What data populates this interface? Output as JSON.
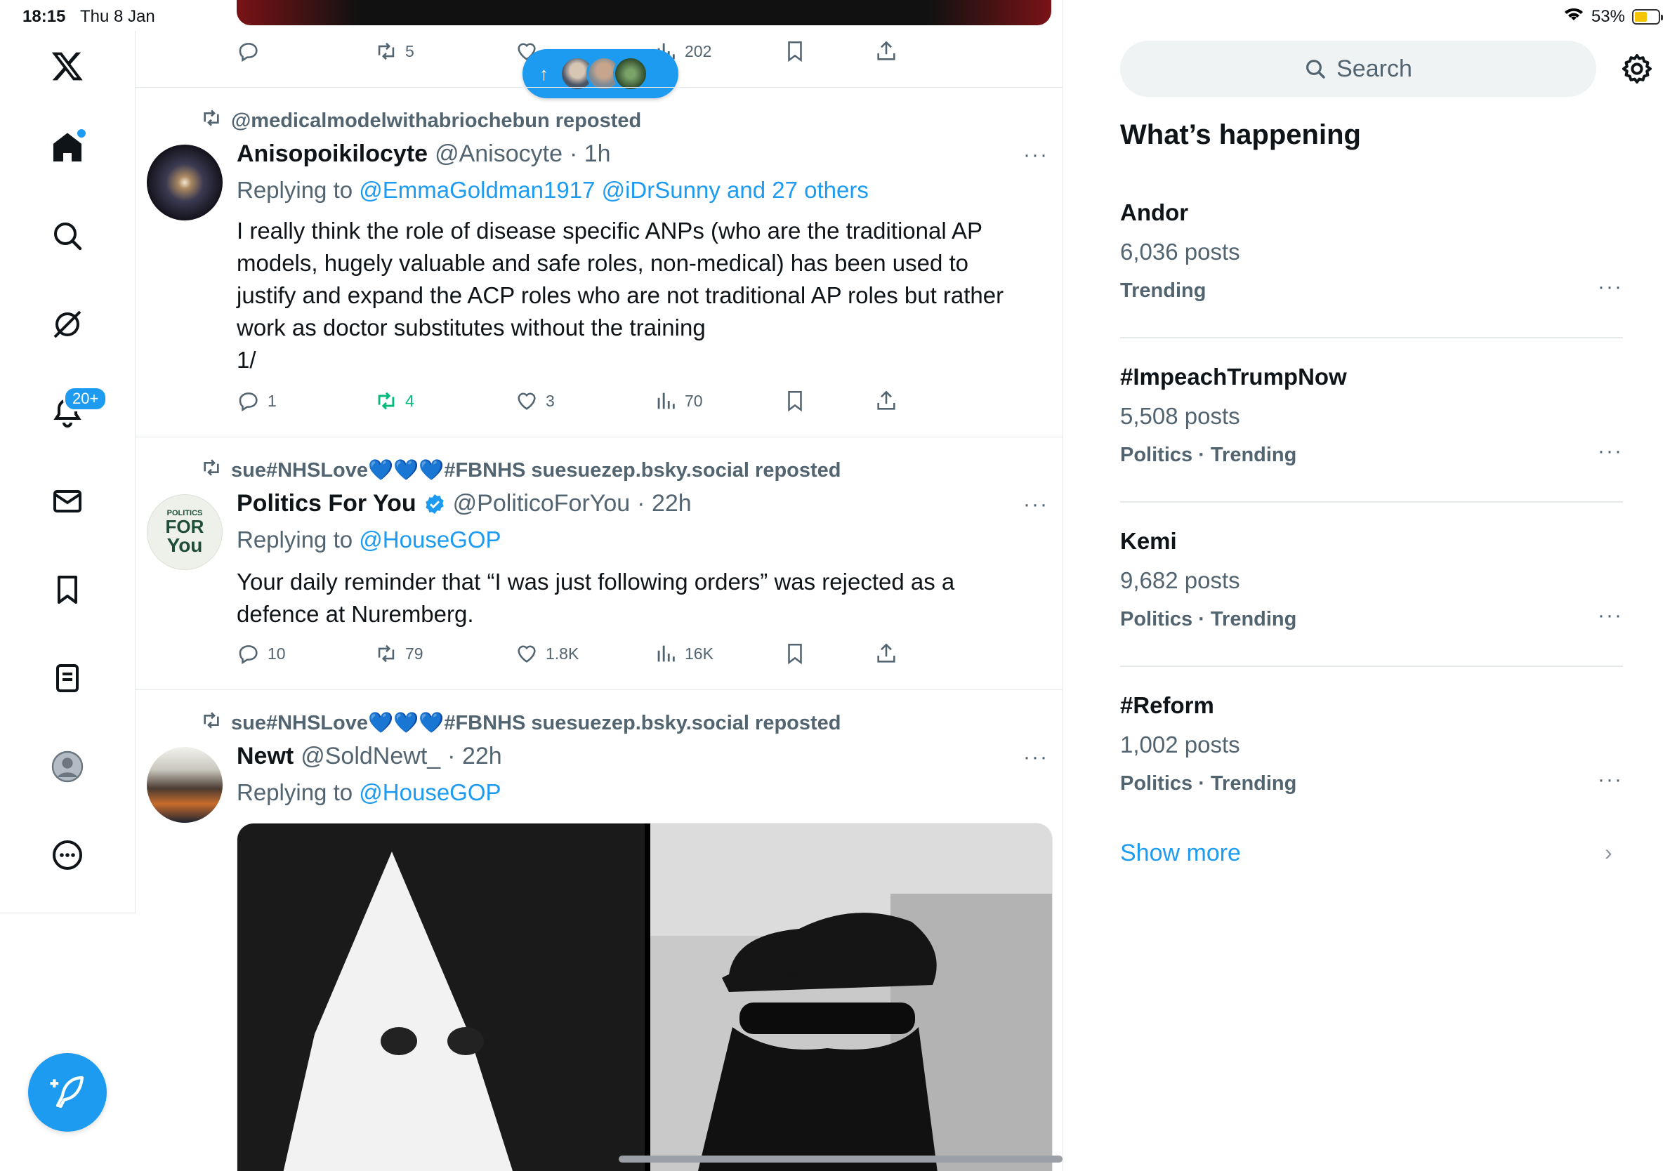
{
  "status_bar": {
    "time": "18:15",
    "date": "Thu 8 Jan",
    "battery": "53%",
    "battery_level": 0.53
  },
  "nav": {
    "notifications_badge": "20+"
  },
  "top_tweet": {
    "retweets": "5",
    "views": "202"
  },
  "new_posts_pill": {
    "arrow": "↑"
  },
  "tweets": [
    {
      "repost_by": "@medicalmodelwithabriochebun reposted",
      "name": "Anisopoikilocyte",
      "handle": "@Anisocyte",
      "time": "· 1h",
      "replying_prefix": "Replying to",
      "replying_to": "@EmmaGoldman1917 @iDrSunny and 27 others",
      "text_lines": [
        "I really think the role of disease specific ANPs (who are the traditional AP",
        "models, hugely valuable and safe roles, non-medical) has been used to",
        "justify and expand the ACP roles who are not traditional AP roles but rather",
        "work as doctor substitutes without the training",
        "1/"
      ],
      "replies": "1",
      "retweets": "4",
      "likes": "3",
      "views": "70",
      "retweeted": true
    },
    {
      "repost_by": "sue#NHSLove💙💙💙#FBNHS suesuezep.bsky.social reposted",
      "name": "Politics For You",
      "handle": "@PoliticoForYou",
      "time": "· 22h",
      "replying_prefix": "Replying to",
      "replying_to": "@HouseGOP",
      "text_lines": [
        "Your daily reminder that “I was just following orders” was rejected as a",
        "defence at Nuremberg."
      ],
      "replies": "10",
      "retweets": "79",
      "likes": "1.8K",
      "views": "16K",
      "avatar_lines": [
        "POLITICS",
        "FOR",
        "You"
      ]
    },
    {
      "repost_by": "sue#NHSLove💙💙💙#FBNHS suesuezep.bsky.social reposted",
      "name": "Newt",
      "handle": "@SoldNewt_",
      "time": "· 22h",
      "replying_prefix": "Replying to",
      "replying_to": "@HouseGOP"
    }
  ],
  "sidebar": {
    "search_placeholder": "Search",
    "section_title": "What’s happening",
    "trends": [
      {
        "name": "Andor",
        "count": "6,036 posts",
        "meta": "Trending"
      },
      {
        "name": "#ImpeachTrumpNow",
        "count": "5,508 posts",
        "meta": "Politics · Trending"
      },
      {
        "name": "Kemi",
        "count": "9,682 posts",
        "meta": "Politics · Trending"
      },
      {
        "name": "#Reform",
        "count": "1,002 posts",
        "meta": "Politics · Trending"
      }
    ],
    "more_dots": "···",
    "show_more": "Show more",
    "chevron": "›"
  },
  "colors": {
    "accent": "#1d9bf0",
    "retweet_green": "#00ba7c",
    "secondary_text": "#536471",
    "divider": "#e6e9ea"
  },
  "icons": [
    "x-logo-icon",
    "home-icon",
    "search-icon",
    "grok-icon",
    "bell-icon",
    "mail-icon",
    "bookmark-icon",
    "list-icon",
    "profile-icon",
    "more-circle-icon",
    "compose-icon",
    "reply-icon",
    "retweet-icon",
    "like-icon",
    "views-icon",
    "share-icon",
    "gear-icon",
    "verified-icon",
    "wifi-icon",
    "battery-icon"
  ]
}
